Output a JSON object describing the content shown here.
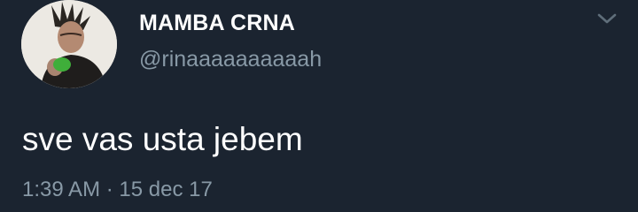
{
  "tweet": {
    "display_name": "MAMBA CRNA",
    "handle": "@rinaaaaaaaaaah",
    "text": "sve vas usta jebem",
    "time": "1:39 AM",
    "separator": "·",
    "date": "15 dec 17",
    "menu_icon": "chevron-down-icon"
  },
  "colors": {
    "background": "#1b2430",
    "primary_text": "#ffffff",
    "secondary_text": "#8899a6"
  }
}
